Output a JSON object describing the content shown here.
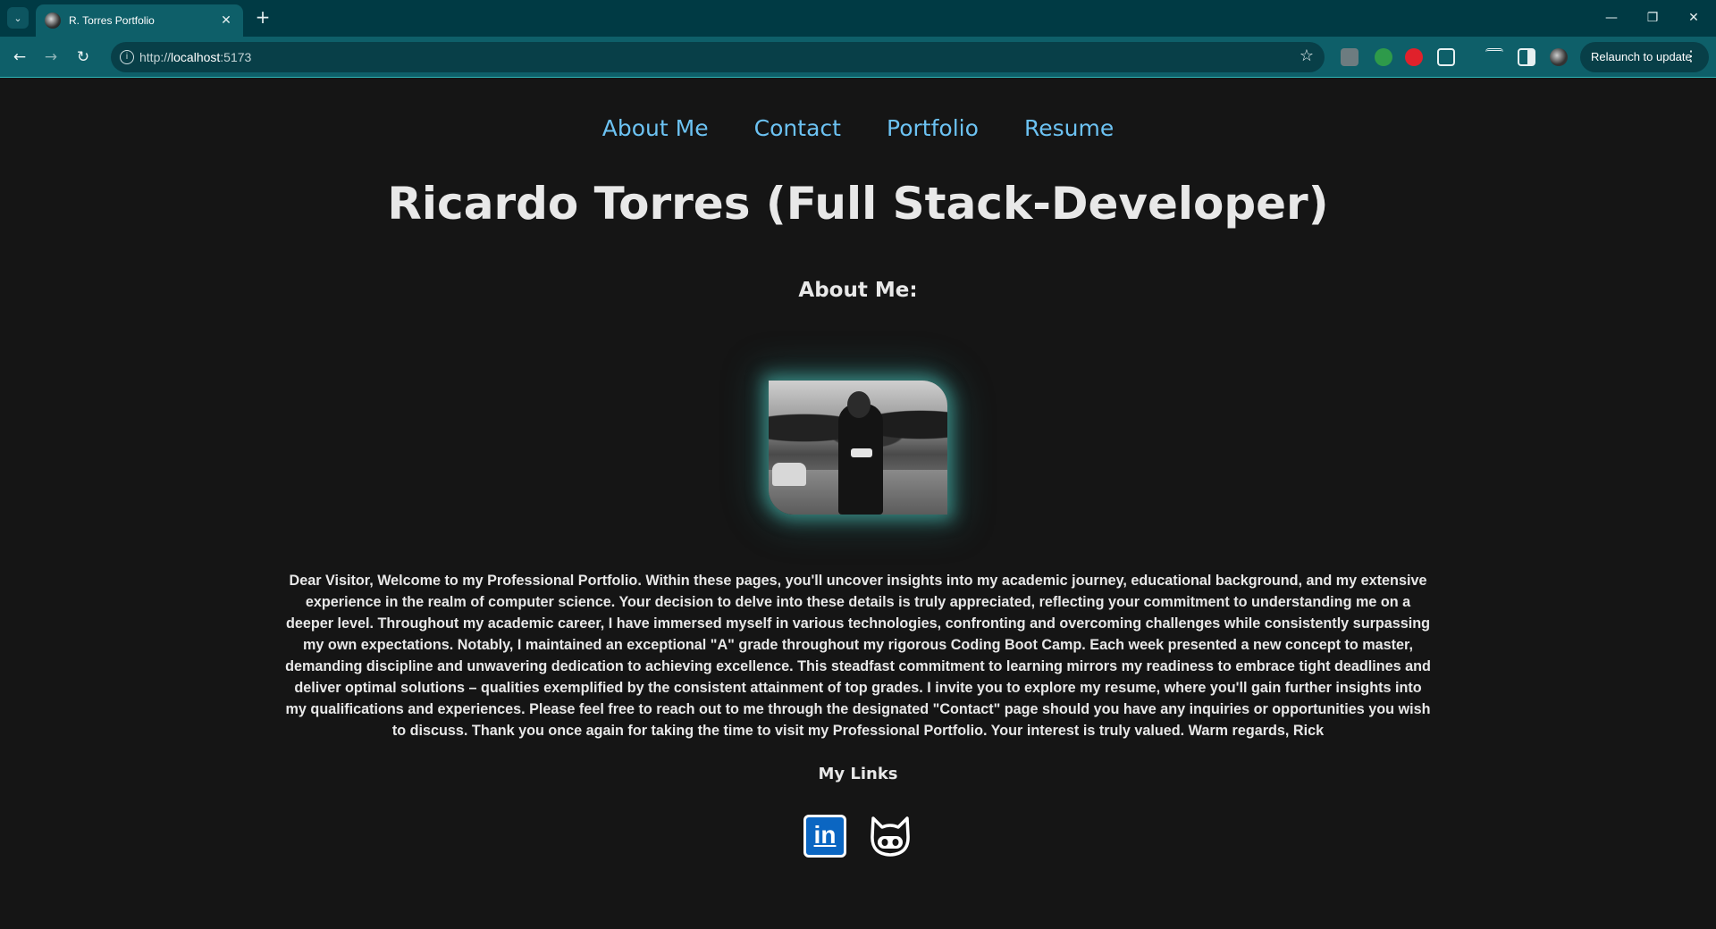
{
  "browser": {
    "tab_title": "R. Torres Portfolio",
    "url_prefix": "http://",
    "url_host": "localhost",
    "url_port": ":5173",
    "relaunch_label": "Relaunch to update",
    "accent": "#0e5f69"
  },
  "nav": {
    "items": [
      "About Me",
      "Contact",
      "Portfolio",
      "Resume"
    ],
    "link_color": "#6cc2f2"
  },
  "page": {
    "title": "Ricardo Torres (Full Stack-Developer)",
    "about_heading": "About Me:",
    "bio": "Dear Visitor, Welcome to my Professional Portfolio. Within these pages, you'll uncover insights into my academic journey, educational background, and my extensive experience in the realm of computer science. Your decision to delve into these details is truly appreciated, reflecting your commitment to understanding me on a deeper level. Throughout my academic career, I have immersed myself in various technologies, confronting and overcoming challenges while consistently surpassing my own expectations. Notably, I maintained an exceptional \"A\" grade throughout my rigorous Coding Boot Camp. Each week presented a new concept to master, demanding discipline and unwavering dedication to achieving excellence. This steadfast commitment to learning mirrors my readiness to embrace tight deadlines and deliver optimal solutions – qualities exemplified by the consistent attainment of top grades. I invite you to explore my resume, where you'll gain further insights into my qualifications and experiences. Please feel free to reach out to me through the designated \"Contact\" page should you have any inquiries or opportunities you wish to discuss. Thank you once again for taking the time to visit my Professional Portfolio. Your interest is truly valued. Warm regards, Rick",
    "links_heading": "My Links",
    "social": [
      {
        "icon": "linkedin-icon",
        "text": "in"
      },
      {
        "icon": "github-icon"
      }
    ],
    "background": "#151515"
  }
}
